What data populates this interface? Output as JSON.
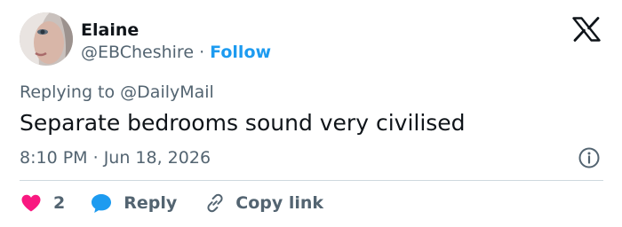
{
  "author": {
    "display_name": "Elaine",
    "handle": "@EBCheshire",
    "separator": "·",
    "follow_label": "Follow"
  },
  "header": {
    "logo_icon": "x-logo-icon"
  },
  "reply_context": {
    "prefix": "Replying to",
    "mention": "@DailyMail"
  },
  "tweet": {
    "text": "Separate bedrooms sound very civilised",
    "time": "8:10 PM",
    "separator": "·",
    "date": "Jun 18, 2026",
    "info_icon": "info-icon"
  },
  "actions": {
    "like_count": "2",
    "like_icon": "heart-icon",
    "reply_label": "Reply",
    "reply_icon": "speech-bubble-icon",
    "copy_label": "Copy link",
    "copy_icon": "link-icon"
  },
  "colors": {
    "link_blue": "#1d9bf0",
    "heart_pink": "#f91880",
    "muted_text": "#536471",
    "primary_text": "#0f1419",
    "divider": "#cfd9de"
  }
}
